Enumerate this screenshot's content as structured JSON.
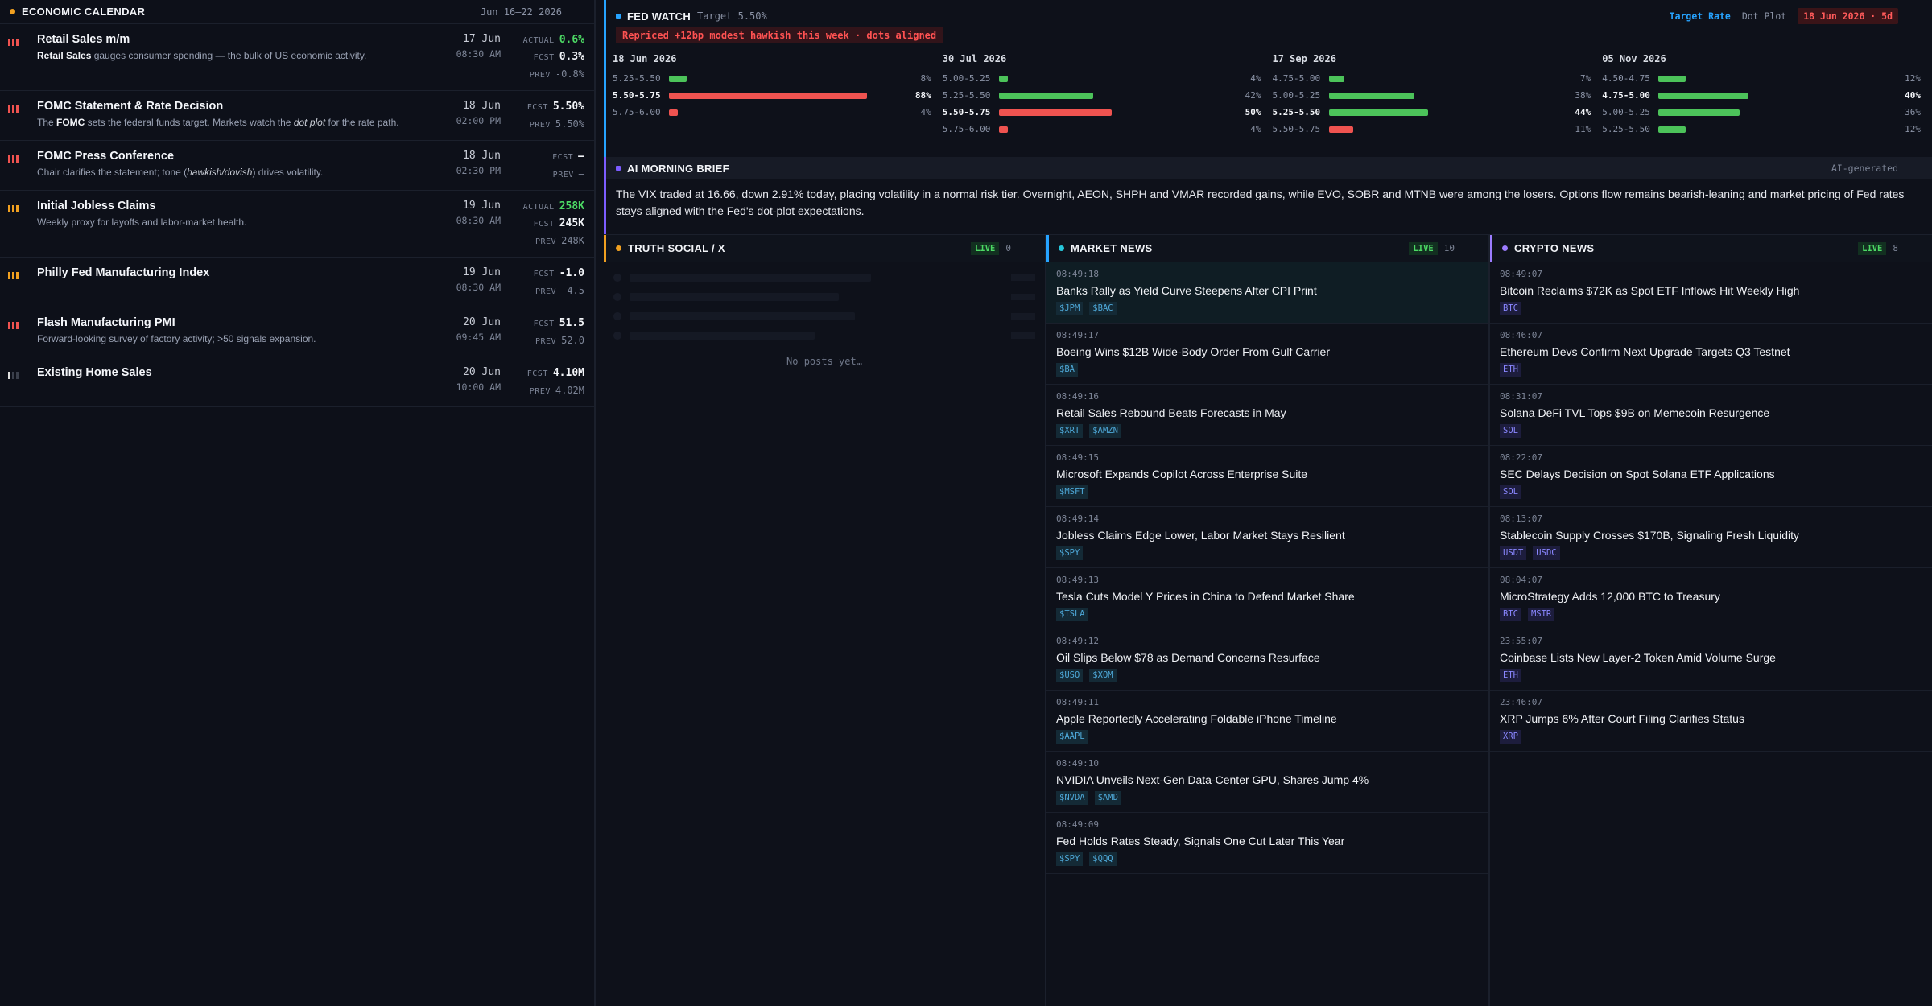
{
  "econ": {
    "title": "ECONOMIC CALENDAR",
    "range": "Jun 16–22 2026",
    "accent": "#f0a020",
    "events": [
      {
        "impact": "high",
        "title": "Retail Sales m/m",
        "desc_bold": "Retail Sales",
        "desc": " gauges consumer spending — the bulk of US economic activity.",
        "date": "17 Jun",
        "time": "08:30 AM",
        "vals": [
          {
            "label": "ACTUAL",
            "value": "0.6%",
            "style": "green"
          },
          {
            "label": "FCST",
            "value": "0.3%",
            "style": ""
          },
          {
            "label": "PREV",
            "value": "-0.8%",
            "style": "prev"
          }
        ]
      },
      {
        "impact": "high",
        "title": "FOMC Statement & Rate Decision",
        "desc_pre": "The ",
        "desc_bold": "FOMC",
        "desc_mid": " sets the federal funds target. Markets watch the ",
        "desc_italic": "dot plot",
        "desc_post": " for the rate path.",
        "date": "18 Jun",
        "time": "02:00 PM",
        "vals": [
          {
            "label": "FCST",
            "value": "5.50%",
            "style": ""
          },
          {
            "label": "PREV",
            "value": "5.50%",
            "style": "prev"
          }
        ]
      },
      {
        "impact": "high",
        "title": "FOMC Press Conference",
        "desc_pre": "Chair clarifies the statement; tone (",
        "desc_italic": "hawkish/dovish",
        "desc_post": ") drives volatility.",
        "date": "18 Jun",
        "time": "02:30 PM",
        "vals": [
          {
            "label": "FCST",
            "value": "—",
            "style": ""
          },
          {
            "label": "PREV",
            "value": "—",
            "style": "prev"
          }
        ]
      },
      {
        "impact": "med",
        "title": "Initial Jobless Claims",
        "desc": "Weekly proxy for layoffs and labor-market health.",
        "date": "19 Jun",
        "time": "08:30 AM",
        "vals": [
          {
            "label": "ACTUAL",
            "value": "258K",
            "style": "green"
          },
          {
            "label": "FCST",
            "value": "245K",
            "style": ""
          },
          {
            "label": "PREV",
            "value": "248K",
            "style": "prev"
          }
        ]
      },
      {
        "impact": "med",
        "title": "Philly Fed Manufacturing Index",
        "desc": "",
        "date": "19 Jun",
        "time": "08:30 AM",
        "vals": [
          {
            "label": "FCST",
            "value": "-1.0",
            "style": ""
          },
          {
            "label": "PREV",
            "value": "-4.5",
            "style": "prev"
          }
        ]
      },
      {
        "impact": "high",
        "title": "Flash Manufacturing PMI",
        "desc": "Forward-looking survey of factory activity; >50 signals expansion.",
        "date": "20 Jun",
        "time": "09:45 AM",
        "vals": [
          {
            "label": "FCST",
            "value": "51.5",
            "style": ""
          },
          {
            "label": "PREV",
            "value": "52.0",
            "style": "prev"
          }
        ]
      },
      {
        "impact": "low",
        "title": "Existing Home Sales",
        "desc": "",
        "date": "20 Jun",
        "time": "10:00 AM",
        "vals": [
          {
            "label": "FCST",
            "value": "4.10M",
            "style": ""
          },
          {
            "label": "PREV",
            "value": "4.02M",
            "style": "prev"
          }
        ]
      }
    ]
  },
  "fed": {
    "title": "FED WATCH",
    "target": "Target 5.50%",
    "tab_active": "Target Rate",
    "tab_inactive": "Dot Plot",
    "date_badge": "18 Jun 2026 · 5d",
    "reprice": "Repriced +12bp modest hawkish this week · dots aligned",
    "meetings": [
      {
        "date": "18 Jun 2026",
        "rows": [
          {
            "range": "5.25-5.50",
            "pct": 8,
            "color": "#4cc35a",
            "hi": false
          },
          {
            "range": "5.50-5.75",
            "pct": 88,
            "color": "#ef5350",
            "hi": true
          },
          {
            "range": "5.75-6.00",
            "pct": 4,
            "color": "#ef5350",
            "hi": false
          }
        ]
      },
      {
        "date": "30 Jul 2026",
        "rows": [
          {
            "range": "5.00-5.25",
            "pct": 4,
            "color": "#4cc35a",
            "hi": false
          },
          {
            "range": "5.25-5.50",
            "pct": 42,
            "color": "#4cc35a",
            "hi": false
          },
          {
            "range": "5.50-5.75",
            "pct": 50,
            "color": "#ef5350",
            "hi": true
          },
          {
            "range": "5.75-6.00",
            "pct": 4,
            "color": "#ef5350",
            "hi": false
          }
        ]
      },
      {
        "date": "17 Sep 2026",
        "rows": [
          {
            "range": "4.75-5.00",
            "pct": 7,
            "color": "#4cc35a",
            "hi": false
          },
          {
            "range": "5.00-5.25",
            "pct": 38,
            "color": "#4cc35a",
            "hi": false
          },
          {
            "range": "5.25-5.50",
            "pct": 44,
            "color": "#4cc35a",
            "hi": true
          },
          {
            "range": "5.50-5.75",
            "pct": 11,
            "color": "#ef5350",
            "hi": false
          }
        ]
      },
      {
        "date": "05 Nov 2026",
        "rows": [
          {
            "range": "4.50-4.75",
            "pct": 12,
            "color": "#4cc35a",
            "hi": false
          },
          {
            "range": "4.75-5.00",
            "pct": 40,
            "color": "#4cc35a",
            "hi": true
          },
          {
            "range": "5.00-5.25",
            "pct": 36,
            "color": "#4cc35a",
            "hi": false
          },
          {
            "range": "5.25-5.50",
            "pct": 12,
            "color": "#4cc35a",
            "hi": false
          }
        ]
      }
    ]
  },
  "brief": {
    "title": "AI MORNING BRIEF",
    "tag": "AI-generated",
    "text": "The VIX traded at 16.66, down 2.91% today, placing volatility in a normal risk tier. Overnight, AEON, SHPH and VMAR recorded gains, while EVO, SOBR and MTNB were among the losers. Options flow remains bearish-leaning and market pricing of Fed rates stays aligned with the Fed's dot-plot expectations."
  },
  "truth": {
    "title": "TRUTH SOCIAL / X",
    "live": "LIVE",
    "count": "0",
    "empty": "No posts yet…"
  },
  "market": {
    "title": "MARKET NEWS",
    "live": "LIVE",
    "count": "10",
    "items": [
      {
        "time": "08:49:18",
        "title": "Banks Rally as Yield Curve Steepens After CPI Print",
        "tags": [
          "$JPM",
          "$BAC"
        ]
      },
      {
        "time": "08:49:17",
        "title": "Boeing Wins $12B Wide-Body Order From Gulf Carrier",
        "tags": [
          "$BA"
        ]
      },
      {
        "time": "08:49:16",
        "title": "Retail Sales Rebound Beats Forecasts in May",
        "tags": [
          "$XRT",
          "$AMZN"
        ]
      },
      {
        "time": "08:49:15",
        "title": "Microsoft Expands Copilot Across Enterprise Suite",
        "tags": [
          "$MSFT"
        ]
      },
      {
        "time": "08:49:14",
        "title": "Jobless Claims Edge Lower, Labor Market Stays Resilient",
        "tags": [
          "$SPY"
        ]
      },
      {
        "time": "08:49:13",
        "title": "Tesla Cuts Model Y Prices in China to Defend Market Share",
        "tags": [
          "$TSLA"
        ]
      },
      {
        "time": "08:49:12",
        "title": "Oil Slips Below $78 as Demand Concerns Resurface",
        "tags": [
          "$USO",
          "$XOM"
        ]
      },
      {
        "time": "08:49:11",
        "title": "Apple Reportedly Accelerating Foldable iPhone Timeline",
        "tags": [
          "$AAPL"
        ]
      },
      {
        "time": "08:49:10",
        "title": "NVIDIA Unveils Next-Gen Data-Center GPU, Shares Jump 4%",
        "tags": [
          "$NVDA",
          "$AMD"
        ]
      },
      {
        "time": "08:49:09",
        "title": "Fed Holds Rates Steady, Signals One Cut Later This Year",
        "tags": [
          "$SPY",
          "$QQQ"
        ]
      }
    ]
  },
  "crypto": {
    "title": "CRYPTO NEWS",
    "live": "LIVE",
    "count": "8",
    "items": [
      {
        "time": "08:49:07",
        "title": "Bitcoin Reclaims $72K as Spot ETF Inflows Hit Weekly High",
        "tags": [
          "BTC"
        ]
      },
      {
        "time": "08:46:07",
        "title": "Ethereum Devs Confirm Next Upgrade Targets Q3 Testnet",
        "tags": [
          "ETH"
        ]
      },
      {
        "time": "08:31:07",
        "title": "Solana DeFi TVL Tops $9B on Memecoin Resurgence",
        "tags": [
          "SOL"
        ]
      },
      {
        "time": "08:22:07",
        "title": "SEC Delays Decision on Spot Solana ETF Applications",
        "tags": [
          "SOL"
        ]
      },
      {
        "time": "08:13:07",
        "title": "Stablecoin Supply Crosses $170B, Signaling Fresh Liquidity",
        "tags": [
          "USDT",
          "USDC"
        ]
      },
      {
        "time": "08:04:07",
        "title": "MicroStrategy Adds 12,000 BTC to Treasury",
        "tags": [
          "BTC",
          "MSTR"
        ]
      },
      {
        "time": "23:55:07",
        "title": "Coinbase Lists New Layer-2 Token Amid Volume Surge",
        "tags": [
          "ETH"
        ]
      },
      {
        "time": "23:46:07",
        "title": "XRP Jumps 6% After Court Filing Clarifies Status",
        "tags": [
          "XRP"
        ]
      }
    ]
  }
}
